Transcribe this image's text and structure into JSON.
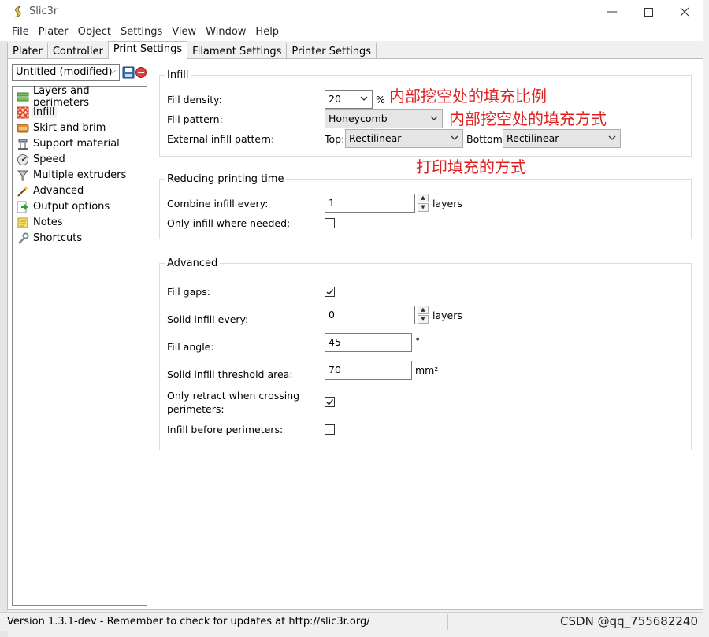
{
  "window": {
    "title": "Slic3r"
  },
  "menu": [
    "File",
    "Plater",
    "Object",
    "Settings",
    "View",
    "Window",
    "Help"
  ],
  "tabs": [
    "Plater",
    "Controller",
    "Print Settings",
    "Filament Settings",
    "Printer Settings"
  ],
  "active_tab": "Print Settings",
  "preset": {
    "value": "Untitled (modified)"
  },
  "tree": [
    {
      "label": "Layers and perimeters",
      "icon": "layers-icon"
    },
    {
      "label": "Infill",
      "icon": "infill-icon",
      "selected": true
    },
    {
      "label": "Skirt and brim",
      "icon": "skirt-icon"
    },
    {
      "label": "Support material",
      "icon": "support-icon"
    },
    {
      "label": "Speed",
      "icon": "speed-icon"
    },
    {
      "label": "Multiple extruders",
      "icon": "funnel-icon"
    },
    {
      "label": "Advanced",
      "icon": "wand-icon"
    },
    {
      "label": "Output options",
      "icon": "output-icon"
    },
    {
      "label": "Notes",
      "icon": "note-icon"
    },
    {
      "label": "Shortcuts",
      "icon": "wrench-icon"
    }
  ],
  "infill": {
    "title": "Infill",
    "density_label": "Fill density:",
    "density_value": "20",
    "density_unit": "%",
    "pattern_label": "Fill pattern:",
    "pattern_value": "Honeycomb",
    "external_label": "External infill pattern:",
    "top_label": "Top:",
    "top_value": "Rectilinear",
    "bottom_label": "Bottom:",
    "bottom_value": "Rectilinear"
  },
  "reducing": {
    "title": "Reducing printing time",
    "combine_label": "Combine infill every:",
    "combine_value": "1",
    "combine_unit": "layers",
    "only_needed_label": "Only infill where needed:",
    "only_needed_checked": false
  },
  "advanced": {
    "title": "Advanced",
    "fill_gaps_label": "Fill gaps:",
    "fill_gaps_checked": true,
    "solid_every_label": "Solid infill every:",
    "solid_every_value": "0",
    "solid_every_unit": "layers",
    "angle_label": "Fill angle:",
    "angle_value": "45",
    "angle_unit": "°",
    "threshold_label": "Solid infill threshold area:",
    "threshold_value": "70",
    "threshold_unit": "mm²",
    "retract_label_1": "Only retract when crossing",
    "retract_label_2": "perimeters:",
    "retract_checked": true,
    "before_perimeters_label": "Infill before perimeters:",
    "before_perimeters_checked": false
  },
  "annotations": {
    "density": "内部挖空处的填充比例",
    "pattern": "内部挖空处的填充方式",
    "external": "打印填充的方式"
  },
  "status": {
    "text": "Version 1.3.1-dev - Remember to check for updates at http://slic3r.org/"
  },
  "watermark": "CSDN @qq_755682240",
  "colors": {
    "annotation": "#e02020",
    "window_bg": "#f0f0f0"
  }
}
